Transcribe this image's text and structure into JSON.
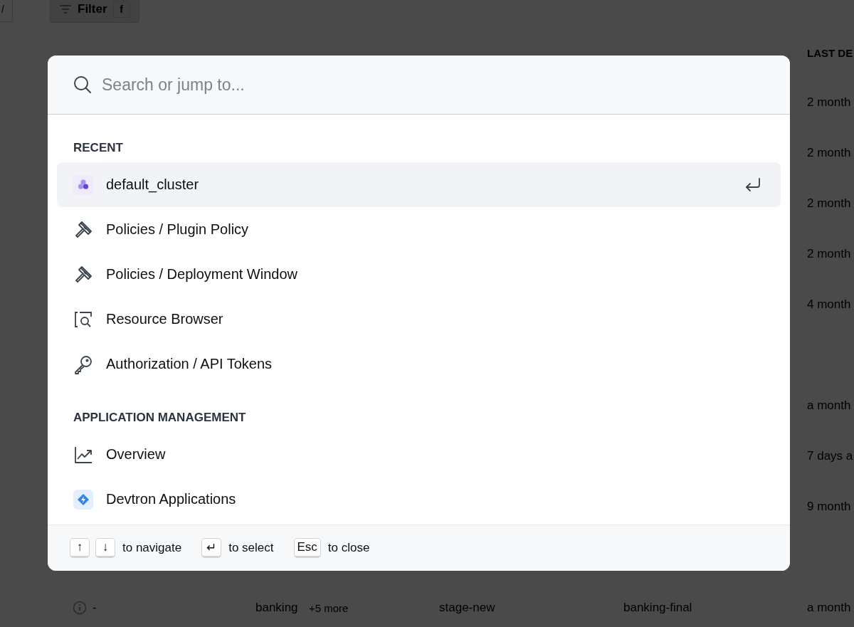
{
  "background": {
    "toolbar": {
      "shortcut_key": "/",
      "filter_button": "Filter",
      "filter_key": "f"
    },
    "table": {
      "column_header": "LAST DE",
      "rows": [
        {
          "last_deployed": "2 month"
        },
        {
          "last_deployed": "2 month"
        },
        {
          "last_deployed": "2 month"
        },
        {
          "last_deployed": "2 month"
        },
        {
          "last_deployed": "4 month"
        },
        {
          "last_deployed": "a month"
        },
        {
          "last_deployed": "7 days a"
        },
        {
          "last_deployed": "9 month"
        }
      ],
      "bottom_row": {
        "status": "-",
        "environment": "banking",
        "more": "+5 more",
        "cluster": "stage-new",
        "namespace": "banking-final",
        "last_deployed": "a month"
      }
    }
  },
  "command_palette": {
    "search": {
      "placeholder": "Search or jump to..."
    },
    "sections": [
      {
        "title": "RECENT",
        "items": [
          {
            "kind": "cluster",
            "label": "default_cluster",
            "selected": true
          },
          {
            "kind": "policy",
            "label": "Policies / Plugin Policy",
            "selected": false
          },
          {
            "kind": "policy",
            "label": "Policies / Deployment Window",
            "selected": false
          },
          {
            "kind": "resource",
            "label": "Resource Browser",
            "selected": false
          },
          {
            "kind": "token",
            "label": "Authorization / API Tokens",
            "selected": false
          }
        ]
      },
      {
        "title": "APPLICATION MANAGEMENT",
        "items": [
          {
            "kind": "overview",
            "label": "Overview",
            "selected": false
          },
          {
            "kind": "app",
            "label": "Devtron Applications",
            "selected": false
          }
        ]
      }
    ],
    "footer": [
      {
        "keys": [
          "↑",
          "↓"
        ],
        "label": "to navigate"
      },
      {
        "keys": [
          "↵"
        ],
        "label": "to select"
      },
      {
        "keys": [
          "Esc"
        ],
        "label": "to close"
      }
    ]
  }
}
